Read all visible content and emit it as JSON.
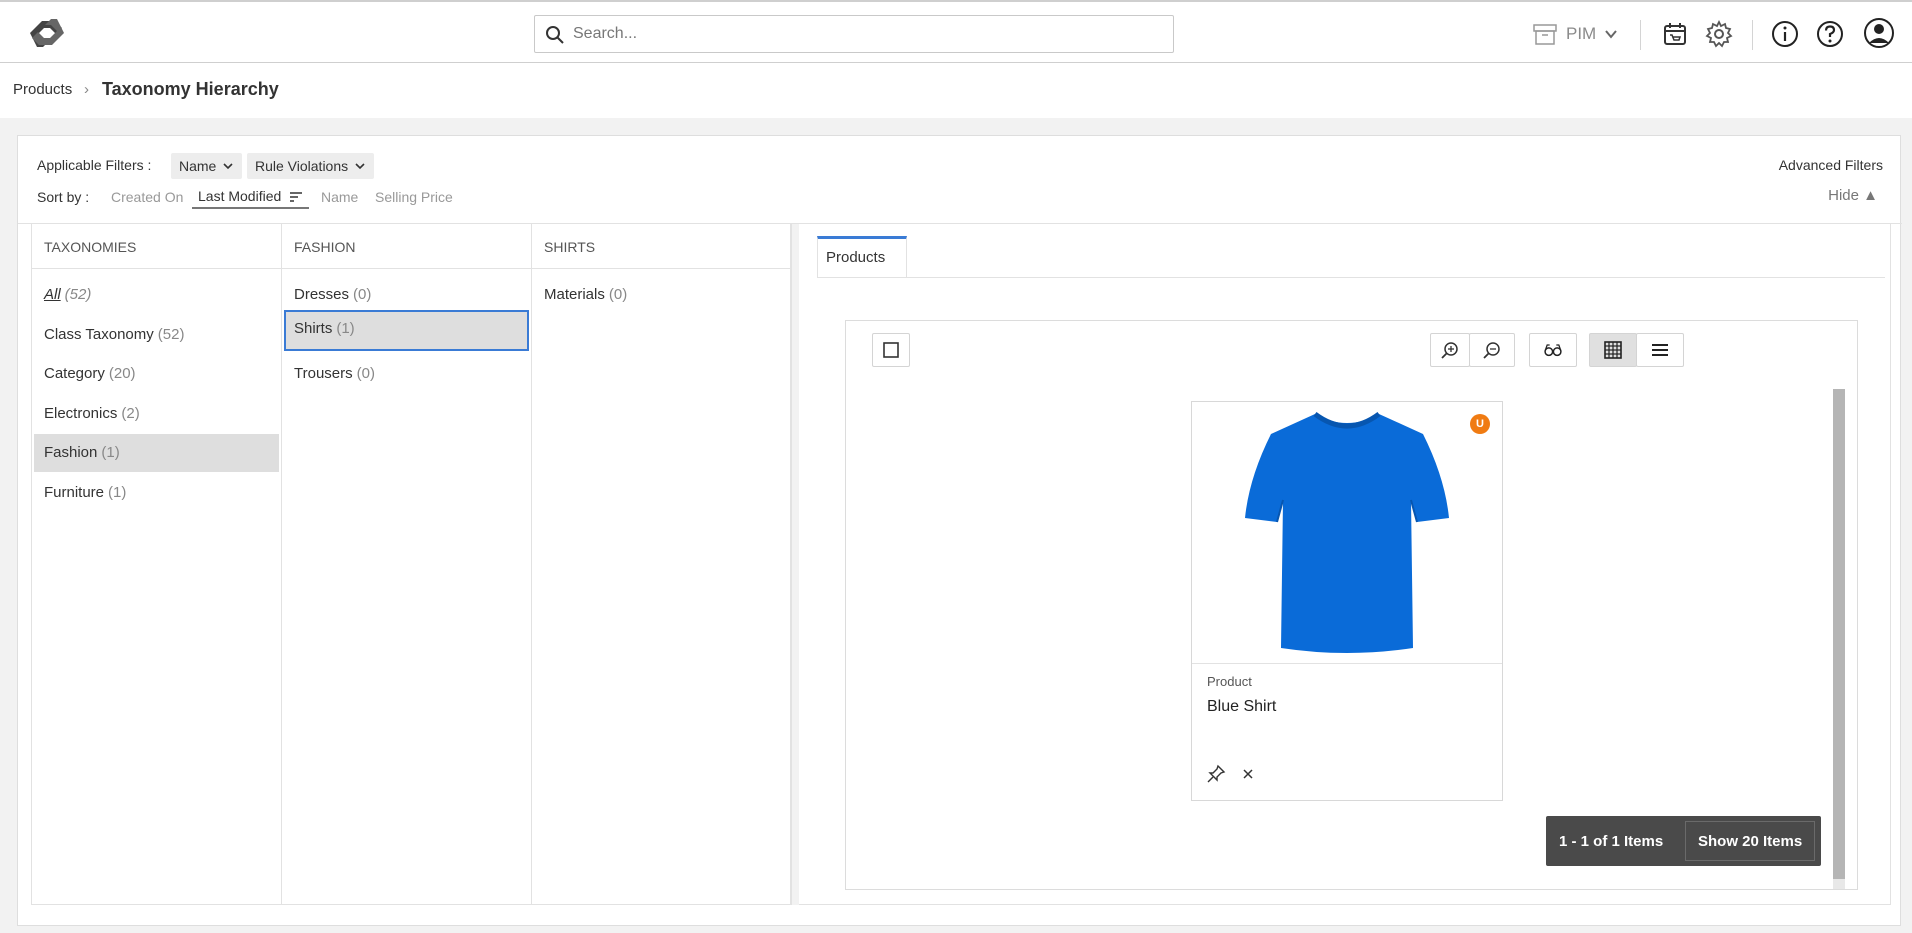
{
  "header": {
    "search_placeholder": "Search...",
    "app_switcher_label": "PIM"
  },
  "breadcrumb": {
    "root": "Products",
    "separator": "›",
    "current": "Taxonomy Hierarchy"
  },
  "filters": {
    "label": "Applicable Filters :",
    "chips": [
      "Name",
      "Rule Violations"
    ],
    "advanced_label": "Advanced Filters"
  },
  "sort": {
    "label": "Sort by :",
    "options": [
      "Created On",
      "Last Modified",
      "Name",
      "Selling Price"
    ],
    "active": "Last Modified",
    "hide_label": "Hide ▲"
  },
  "columns": [
    {
      "header": "TAXONOMIES",
      "items": [
        {
          "name": "All",
          "count": "(52)"
        },
        {
          "name": "Class Taxonomy",
          "count": "(52)"
        },
        {
          "name": "Category",
          "count": "(20)"
        },
        {
          "name": "Electronics",
          "count": "(2)"
        },
        {
          "name": "Fashion",
          "count": "(1)"
        },
        {
          "name": "Furniture",
          "count": "(1)"
        }
      ],
      "selected": "Fashion"
    },
    {
      "header": "FASHION",
      "items": [
        {
          "name": "Dresses",
          "count": "(0)"
        },
        {
          "name": "Shirts",
          "count": "(1)"
        },
        {
          "name": "Trousers",
          "count": "(0)"
        }
      ],
      "selected": "Shirts"
    },
    {
      "header": "SHIRTS",
      "items": [
        {
          "name": "Materials",
          "count": "(0)"
        }
      ]
    }
  ],
  "results": {
    "tab_label": "Products",
    "card": {
      "badge": "U",
      "type": "Product",
      "name": "Blue Shirt",
      "image_color": "#0a6bd8"
    },
    "pager_info": "1 - 1 of 1 Items",
    "pager_button": "Show 20 Items"
  },
  "colors": {
    "accent": "#3a7bd5",
    "badge": "#f07b12"
  },
  "icons": [
    "logo-icon",
    "search-icon",
    "archive-icon",
    "chevron-down-icon",
    "calendar-cart-icon",
    "gear-icon",
    "info-icon",
    "help-icon",
    "user-icon",
    "sort-lines-icon",
    "checkbox-icon",
    "zoom-in-icon",
    "zoom-out-icon",
    "glasses-icon",
    "grid-view-icon",
    "list-view-icon",
    "pin-icon",
    "close-icon"
  ]
}
